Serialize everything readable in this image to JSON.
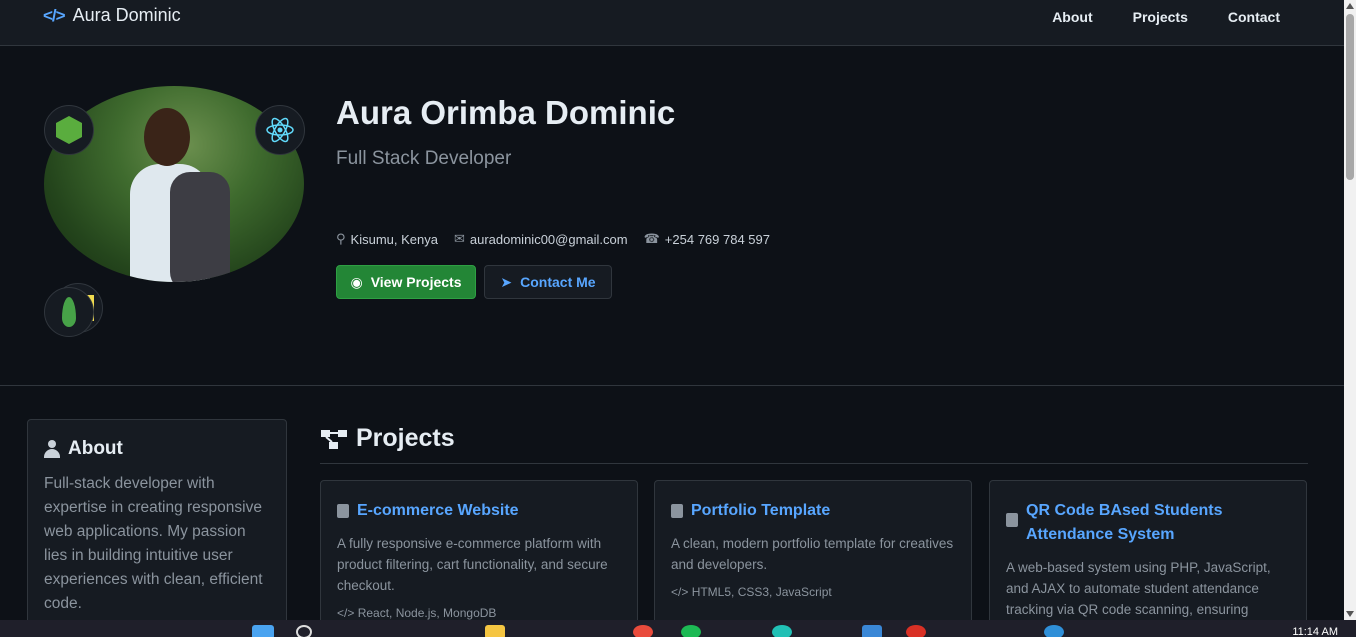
{
  "nav": {
    "brand": "Aura Dominic",
    "links": [
      "About",
      "Projects",
      "Contact"
    ]
  },
  "hero": {
    "name": "Aura Orimba Dominic",
    "role": "Full Stack Developer",
    "location": "Kisumu, Kenya",
    "email": "auradominic00@gmail.com",
    "phone": "+254 769 784 597",
    "view_projects": "View Projects",
    "contact_me": "Contact Me"
  },
  "about": {
    "title": "About",
    "text": "Full-stack developer with expertise in creating responsive web applications. My passion lies in building intuitive user experiences with clean, efficient code."
  },
  "projects": {
    "title": "Projects",
    "items": [
      {
        "title": "E-commerce Website",
        "description": "A fully responsive e-commerce platform with product filtering, cart functionality, and secure checkout.",
        "tech": "React, Node.js, MongoDB"
      },
      {
        "title": "Portfolio Template",
        "description": "A clean, modern portfolio template for creatives and developers.",
        "tech": "HTML5, CSS3, JavaScript"
      },
      {
        "title": "QR Code BAsed Students Attendance System",
        "description": "A web-based system using PHP, JavaScript, and AJAX to automate student attendance tracking via QR code scanning, ensuring",
        "tech": ""
      }
    ]
  },
  "taskbar": {
    "time": "11:14 AM"
  },
  "colors": {
    "background": "#0d1117",
    "surface": "#161b22",
    "accent": "#58a6ff",
    "primary_button": "#238636"
  }
}
